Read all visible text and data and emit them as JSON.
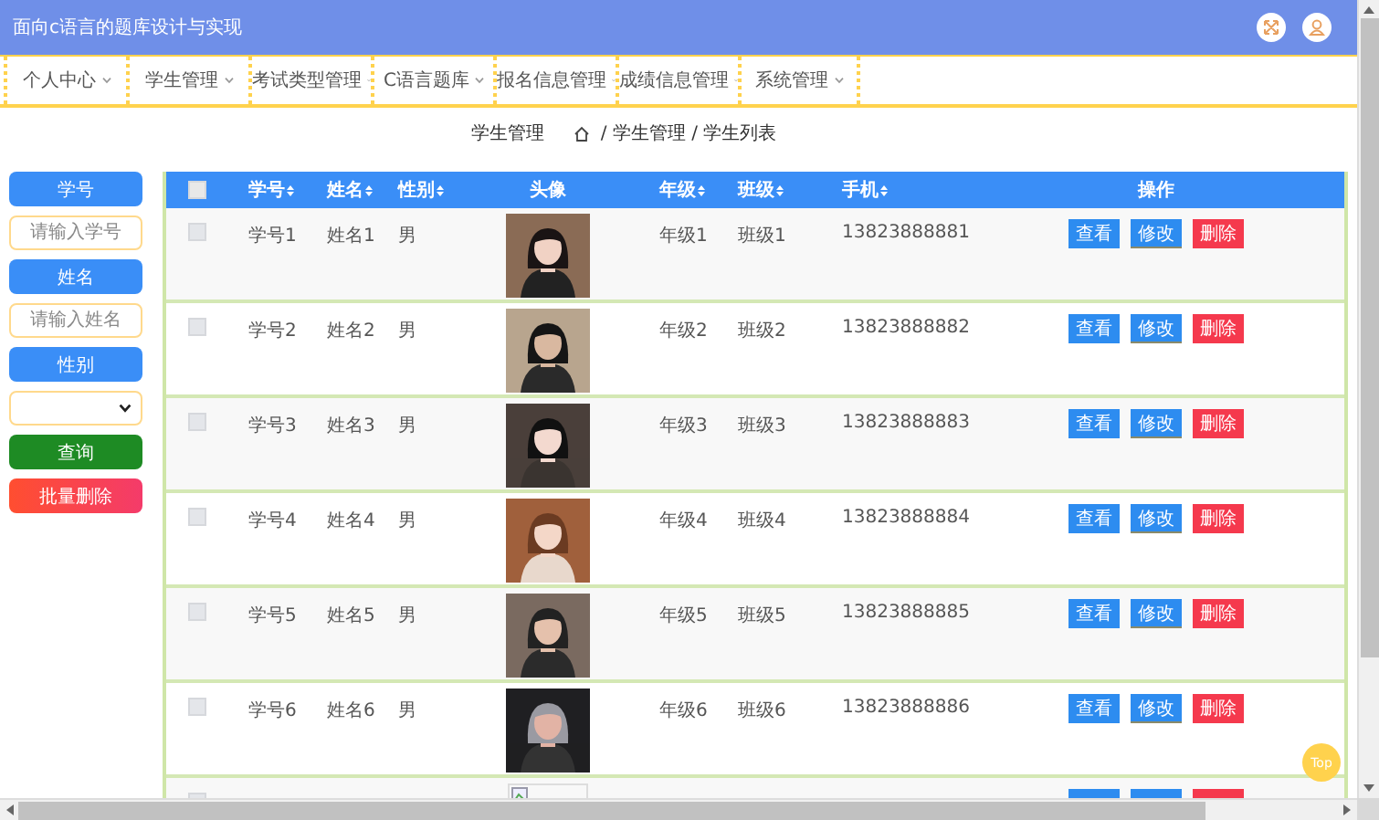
{
  "header": {
    "title": "面向c语言的题库设计与实现"
  },
  "nav": [
    {
      "label": "个人中心"
    },
    {
      "label": "学生管理"
    },
    {
      "label": "考试类型管理"
    },
    {
      "label": "C语言题库"
    },
    {
      "label": "报名信息管理"
    },
    {
      "label": "成绩信息管理"
    },
    {
      "label": "系统管理"
    }
  ],
  "breadcrumb": {
    "section": "学生管理",
    "path": "/ 学生管理 / 学生列表"
  },
  "filters": [
    {
      "kind": "label",
      "text": "学号"
    },
    {
      "kind": "input",
      "placeholder": "请输入学号"
    },
    {
      "kind": "label",
      "text": "姓名"
    },
    {
      "kind": "input",
      "placeholder": "请输入姓名"
    },
    {
      "kind": "label",
      "text": "性别"
    },
    {
      "kind": "select"
    },
    {
      "kind": "query",
      "text": "查询"
    },
    {
      "kind": "batch-delete",
      "text": "批量删除"
    }
  ],
  "table": {
    "select_all_checked": false,
    "columns": [
      {
        "label": "学号",
        "sortable": true
      },
      {
        "label": "姓名",
        "sortable": true
      },
      {
        "label": "性别",
        "sortable": true
      },
      {
        "label": "头像",
        "sortable": false
      },
      {
        "label": "年级",
        "sortable": true
      },
      {
        "label": "班级",
        "sortable": true
      },
      {
        "label": "手机",
        "sortable": true
      },
      {
        "label": "操作",
        "sortable": false
      }
    ],
    "rows": [
      {
        "checked": false,
        "cells": [
          "学号1",
          "姓名1",
          "男",
          "",
          "年级1",
          "班级1",
          "13823888881"
        ],
        "avatar": {
          "kind": "picture"
        },
        "actions": [
          {
            "kind": "view",
            "label": "查看"
          },
          {
            "kind": "edit",
            "label": "修改"
          },
          {
            "kind": "delete",
            "label": "删除"
          }
        ]
      },
      {
        "checked": false,
        "cells": [
          "学号2",
          "姓名2",
          "男",
          "",
          "年级2",
          "班级2",
          "13823888882"
        ],
        "avatar": {
          "kind": "picture"
        },
        "actions": [
          {
            "kind": "view",
            "label": "查看"
          },
          {
            "kind": "edit",
            "label": "修改"
          },
          {
            "kind": "delete",
            "label": "删除"
          }
        ]
      },
      {
        "checked": false,
        "cells": [
          "学号3",
          "姓名3",
          "男",
          "",
          "年级3",
          "班级3",
          "13823888883"
        ],
        "avatar": {
          "kind": "picture"
        },
        "actions": [
          {
            "kind": "view",
            "label": "查看"
          },
          {
            "kind": "edit",
            "label": "修改"
          },
          {
            "kind": "delete",
            "label": "删除"
          }
        ]
      },
      {
        "checked": false,
        "cells": [
          "学号4",
          "姓名4",
          "男",
          "",
          "年级4",
          "班级4",
          "13823888884"
        ],
        "avatar": {
          "kind": "picture"
        },
        "actions": [
          {
            "kind": "view",
            "label": "查看"
          },
          {
            "kind": "edit",
            "label": "修改"
          },
          {
            "kind": "delete",
            "label": "删除"
          }
        ]
      },
      {
        "checked": false,
        "cells": [
          "学号5",
          "姓名5",
          "男",
          "",
          "年级5",
          "班级5",
          "13823888885"
        ],
        "avatar": {
          "kind": "picture"
        },
        "actions": [
          {
            "kind": "view",
            "label": "查看"
          },
          {
            "kind": "edit",
            "label": "修改"
          },
          {
            "kind": "delete",
            "label": "删除"
          }
        ]
      },
      {
        "checked": false,
        "cells": [
          "学号6",
          "姓名6",
          "男",
          "",
          "年级6",
          "班级6",
          "13823888886"
        ],
        "avatar": {
          "kind": "picture"
        },
        "actions": [
          {
            "kind": "view",
            "label": "查看"
          },
          {
            "kind": "edit",
            "label": "修改"
          },
          {
            "kind": "delete",
            "label": "删除"
          }
        ]
      },
      {
        "checked": false,
        "avatar": {
          "kind": "broken"
        },
        "actions": [
          {
            "kind": "view"
          },
          {
            "kind": "edit"
          },
          {
            "kind": "delete"
          }
        ]
      }
    ]
  },
  "back_to_top": {
    "label": "Top"
  }
}
